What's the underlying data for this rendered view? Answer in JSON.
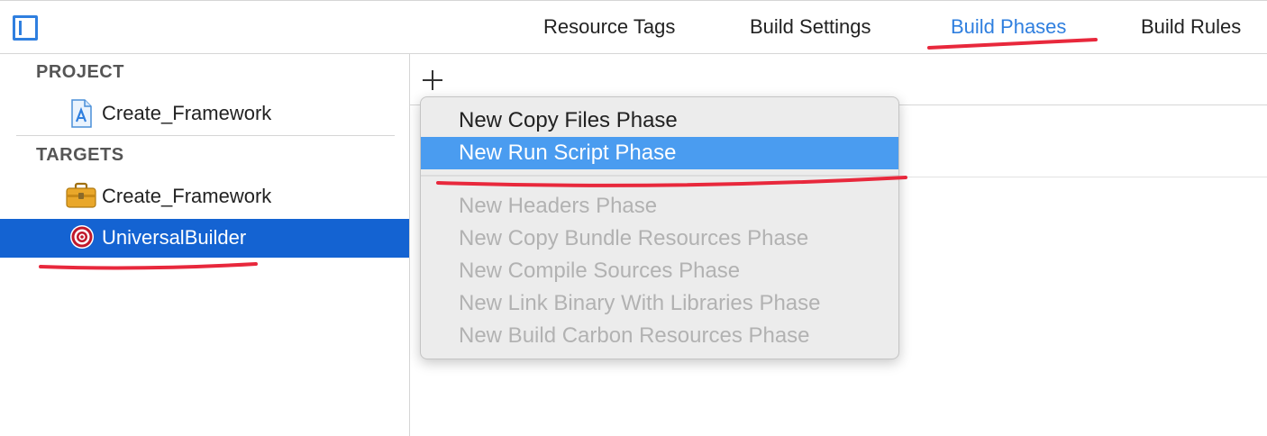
{
  "toolbar": {
    "sidebar_toggle_icon": "sidebar-toggle-icon",
    "tabs": [
      {
        "label": "Resource Tags",
        "active": false
      },
      {
        "label": "Build Settings",
        "active": false
      },
      {
        "label": "Build Phases",
        "active": true
      },
      {
        "label": "Build Rules",
        "active": false
      }
    ],
    "accent_color": "#2f7fdf"
  },
  "sidebar": {
    "project_header": "PROJECT",
    "project_item": {
      "label": "Create_Framework",
      "icon": "xcode-project-icon"
    },
    "targets_header": "TARGETS",
    "targets": [
      {
        "label": "Create_Framework",
        "icon": "toolbox-icon",
        "selected": false
      },
      {
        "label": "UniversalBuilder",
        "icon": "target-icon",
        "selected": true
      }
    ],
    "selection_color": "#1463d2"
  },
  "main": {
    "add_button_icon": "plus-icon"
  },
  "menu": {
    "items": [
      {
        "label": "New Copy Files Phase",
        "enabled": true,
        "selected": false
      },
      {
        "label": "New Run Script Phase",
        "enabled": true,
        "selected": true
      },
      {
        "label": "New Headers Phase",
        "enabled": false,
        "selected": false
      },
      {
        "label": "New Copy Bundle Resources Phase",
        "enabled": false,
        "selected": false
      },
      {
        "label": "New Compile Sources Phase",
        "enabled": false,
        "selected": false
      },
      {
        "label": "New Link Binary With Libraries Phase",
        "enabled": false,
        "selected": false
      },
      {
        "label": "New Build Carbon Resources Phase",
        "enabled": false,
        "selected": false
      }
    ],
    "highlight_color": "#4a9cf0"
  },
  "annotations": {
    "stroke_color": "#e8283c"
  }
}
